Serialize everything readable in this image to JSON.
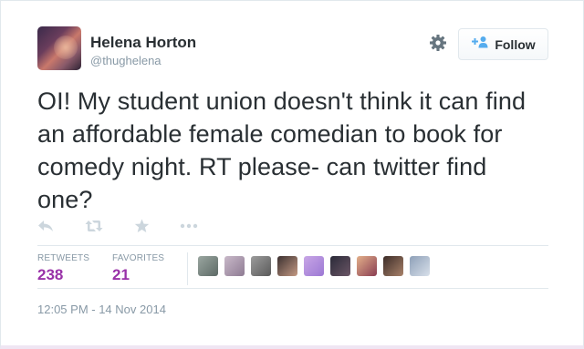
{
  "user": {
    "display_name": "Helena Horton",
    "handle": "@thughelena"
  },
  "follow_button": {
    "label": "Follow"
  },
  "tweet": {
    "text_lines": [
      "OI! My student union doesn't think it can find",
      "an affordable female comedian to book for",
      "comedy night. RT please- can twitter find",
      "one?"
    ]
  },
  "actions": {
    "icons": [
      "reply-icon",
      "retweet-icon",
      "favorite-icon",
      "more-icon"
    ]
  },
  "stats": {
    "retweets_label": "RETWEETS",
    "retweets_count": "238",
    "favorites_label": "FAVORITES",
    "favorites_count": "21"
  },
  "favorited_by_avatars": 9,
  "timestamp": "12:05 PM - 14 Nov 2014",
  "colors": {
    "text": "#292f33",
    "muted": "#8899a6",
    "stat_value": "#9932a8",
    "border": "#e1e8ed",
    "icon": "#ccd6dd",
    "follow_icon": "#55acee"
  }
}
